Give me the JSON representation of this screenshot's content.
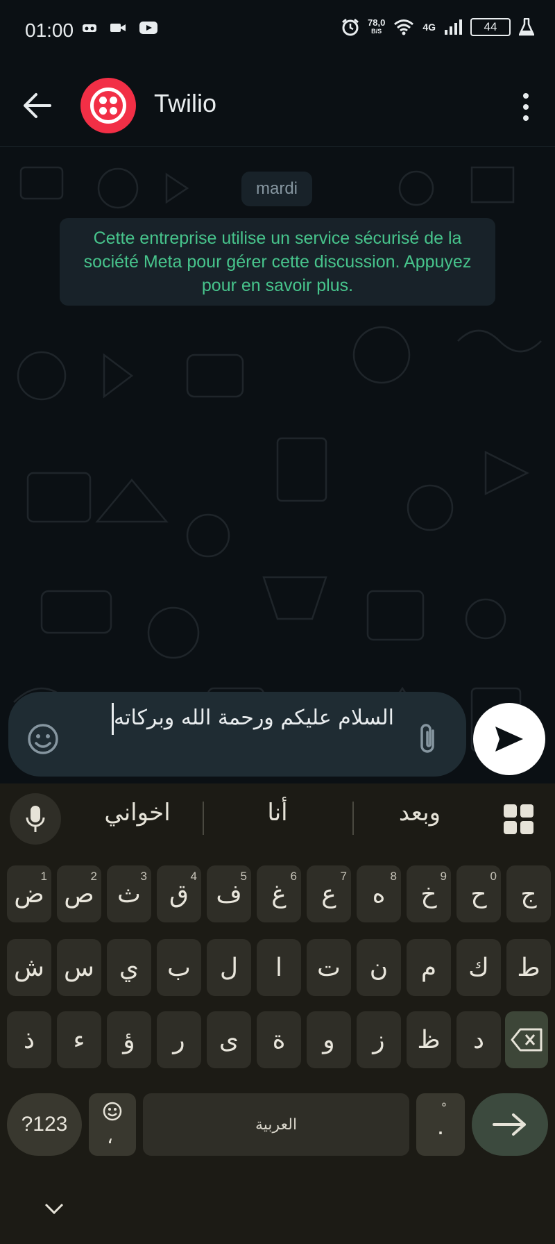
{
  "status_bar": {
    "time": "01:00",
    "net_speed": "78,0",
    "net_speed_unit": "B/S",
    "network": "4G",
    "battery": "44"
  },
  "header": {
    "contact_name": "Twilio"
  },
  "chat": {
    "date_chip": "mardi",
    "system_message": "Cette entreprise utilise un service sécurisé de la société Meta pour gérer cette discussion. Appuyez pour en savoir plus."
  },
  "composer": {
    "text": "السلام عليكم ورحمة الله وبركاته"
  },
  "keyboard": {
    "suggestions": [
      "اخواني",
      "أنا",
      "وبعد"
    ],
    "row1": [
      {
        "c": "ض",
        "n": "1"
      },
      {
        "c": "ص",
        "n": "2"
      },
      {
        "c": "ث",
        "n": "3"
      },
      {
        "c": "ق",
        "n": "4"
      },
      {
        "c": "ف",
        "n": "5"
      },
      {
        "c": "غ",
        "n": "6"
      },
      {
        "c": "ع",
        "n": "7"
      },
      {
        "c": "ه",
        "n": "8"
      },
      {
        "c": "خ",
        "n": "9"
      },
      {
        "c": "ح",
        "n": "0"
      },
      {
        "c": "ج",
        "n": ""
      }
    ],
    "row2": [
      "ش",
      "س",
      "ي",
      "ب",
      "ل",
      "ا",
      "ت",
      "ن",
      "م",
      "ك",
      "ط"
    ],
    "row3": [
      "ذ",
      "ء",
      "ؤ",
      "ر",
      "ى",
      "ة",
      "و",
      "ز",
      "ظ",
      "د"
    ],
    "symbols_label": "?123",
    "emoji_comma": "،",
    "space_label": "العربية",
    "period_label": "."
  }
}
